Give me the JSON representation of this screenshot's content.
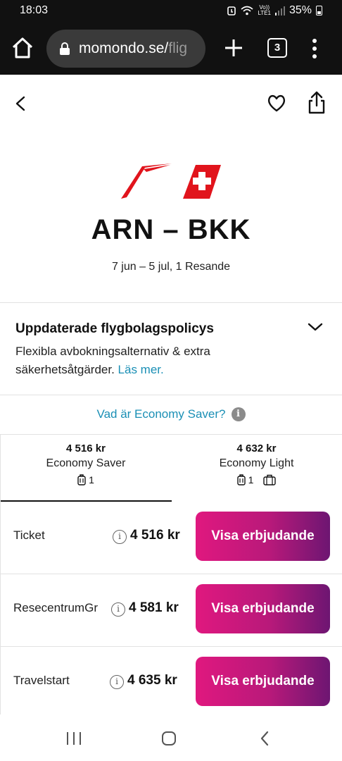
{
  "status_bar": {
    "time": "18:03",
    "network_top": "Vo))",
    "network_bottom": "LTE1",
    "battery": "35%"
  },
  "browser": {
    "url_main": "momondo.se/",
    "url_faded": "flig",
    "tab_count": "3"
  },
  "hero": {
    "route": "ARN – BKK",
    "dates": "7 jun – 5 jul, 1 Resande",
    "brand_colors": {
      "swiss_red": "#e1141c"
    }
  },
  "policy": {
    "title": "Uppdaterade flygbolagspolicys",
    "body": "Flexibla avbokningsalternativ & extra säkerhetsåtgärder.",
    "link": "Läs mer."
  },
  "info_link": {
    "text": "Vad är Economy Saver?",
    "icon": "i"
  },
  "fares": [
    {
      "price": "4 516 kr",
      "name": "Economy Saver",
      "bag_count": "1",
      "selected": true
    },
    {
      "price": "4 632 kr",
      "name": "Economy Light",
      "bag_count": "1",
      "selected": false
    }
  ],
  "offers": [
    {
      "provider": "Ticket",
      "price": "4 516 kr",
      "cta": "Visa erbjudande"
    },
    {
      "provider": "ResecentrumGr",
      "price": "4 581 kr",
      "cta": "Visa erbjudande"
    },
    {
      "provider": "Travelstart",
      "price": "4 635 kr",
      "cta": "Visa erbjudande"
    }
  ],
  "colors": {
    "cta_gradient_start": "#e0187f",
    "cta_gradient_end": "#6d1672",
    "link": "#1a8fb5"
  }
}
